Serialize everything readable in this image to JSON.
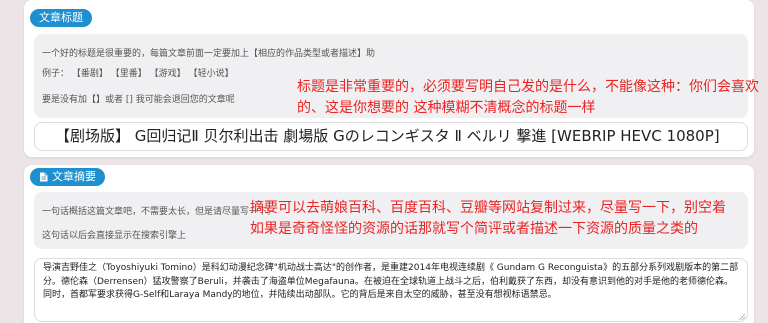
{
  "title_section": {
    "label": "文章标题",
    "hint_1": "一个好的标题是很重要的，每篇文章前面一定要加上【相应的作品类型或者描述】",
    "hint_1_suffix": "助",
    "example_label": "例子：",
    "examples": [
      "【番剧】",
      "【里番】",
      "【游戏】",
      "【轻小说】"
    ],
    "hint_2": "要是没有加【】或者 [] 我可能会退回您的文章呢",
    "red_note_1": "标题是非常重要的，必须要写明自己发的是什么，不能像这种：你们会喜欢",
    "red_note_2": "的、这是你想要的  这种模糊不清概念的标题一样",
    "input_value": "【剧场版】 G回归记Ⅱ 贝尔利出击 劇場版 Gのレコンギスタ Ⅱ ベルリ 撃進 [WEBRIP HEVC 1080P]"
  },
  "summary_section": {
    "label": "文章摘要",
    "icon": "document-icon",
    "hint_1": "一句话概括这篇文章吧，不需要太长，但是请尽量写一下。",
    "hint_2": "这句话以后会直接显示在搜索引擎上",
    "red_note_1": "摘要可以去萌娘百科、百度百科、豆瓣等网站复制过来，尽量写一下，别空着",
    "red_note_2": "如果是奇奇怪怪的资源的话那就写个简评或者描述一下资源的质量之类的",
    "input_lines": [
      "导演吉野佳之（Toyoshiyuki Tomino）是科幻动漫纪念碑\"机动战士高达\"的创作者，是重建2014年电视连续剧《 Gundam G Reconguista》的五部分系列戏剧版本的第二部",
      "分。德伦森（Derrensen）猛攻警察了Beruli，并袭击了海盗单位Megafauna。在被迫在全球轨道上战斗之后，伯利戴获了东西，却没有意识到他的对手是他的老师德伦森。",
      "同时，首都军要求获得G-Self和Laraya Mandy的地位，并陆续出动部队。它的背后是来自太空的威胁，甚至没有想视标语禁忌。"
    ]
  },
  "colors": {
    "accent": "#1e90cf",
    "note_red": "#ea2424",
    "background": "#ece4e6"
  }
}
